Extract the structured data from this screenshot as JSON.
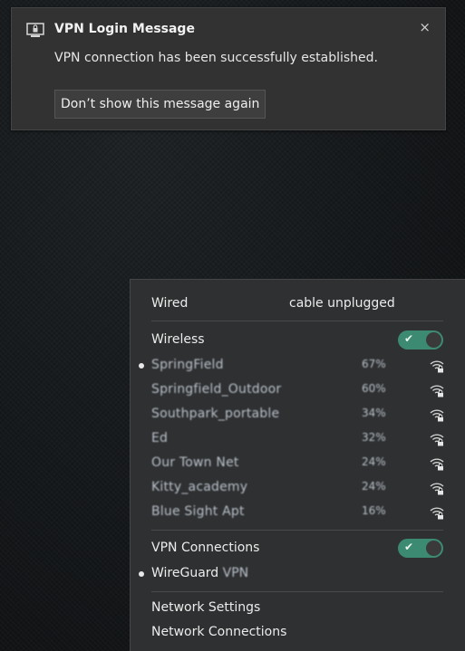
{
  "notification": {
    "title": "VPN Login Message",
    "message": "VPN connection has been successfully established.",
    "dismiss_button": "Don’t show this message again",
    "close_glyph": "×",
    "icon": "vpn-lock-icon"
  },
  "menu": {
    "wired": {
      "label": "Wired",
      "status": "cable unplugged"
    },
    "wireless": {
      "label": "Wireless",
      "enabled": true
    },
    "networks": [
      {
        "name": "SpringField",
        "strength": "67%",
        "connected": true
      },
      {
        "name": "Springfield_Outdoor",
        "strength": "60%",
        "connected": false
      },
      {
        "name": "Southpark_portable",
        "strength": "34%",
        "connected": false
      },
      {
        "name": "Ed",
        "strength": "32%",
        "connected": false
      },
      {
        "name": "Our Town Net",
        "strength": "24%",
        "connected": false
      },
      {
        "name": "Kitty_academy",
        "strength": "24%",
        "connected": false
      },
      {
        "name": "Blue Sight Apt",
        "strength": "16%",
        "connected": false
      }
    ],
    "vpn": {
      "label": "VPN Connections",
      "enabled": true,
      "connection_name": "WireGuard",
      "connection_suffix": "VPN"
    },
    "network_settings": "Network Settings",
    "network_connections": "Network Connections"
  },
  "colors": {
    "accent_toggle": "#3d8a72",
    "menu_bg": "#2f3031",
    "notification_bg": "#323232"
  }
}
